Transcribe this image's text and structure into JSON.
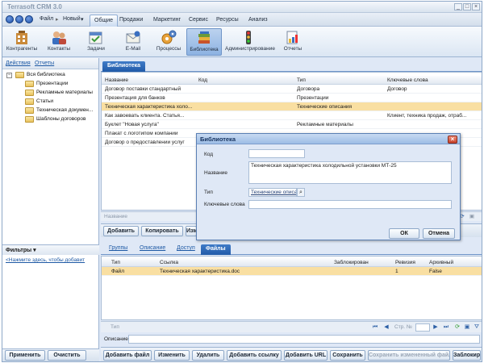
{
  "app": {
    "title": "Terrasoft CRM 3.0"
  },
  "menu": {
    "file": "Файл",
    "new": "Новый",
    "tabs": [
      "Общие",
      "Продажи",
      "Маркетинг",
      "Сервис",
      "Ресурсы",
      "Анализ"
    ],
    "active_tab": "Общие"
  },
  "ribbon": {
    "items": [
      {
        "label": "Контрагенты",
        "icon": "accounts-icon"
      },
      {
        "label": "Контакты",
        "icon": "contacts-icon"
      },
      {
        "label": "Задачи",
        "icon": "tasks-icon"
      },
      {
        "label": "E-Mail",
        "icon": "email-icon"
      },
      {
        "label": "Процессы",
        "icon": "processes-icon"
      },
      {
        "label": "Библиотека",
        "icon": "library-icon",
        "active": true
      },
      {
        "label": "Администрирование",
        "icon": "admin-icon"
      },
      {
        "label": "Отчеты",
        "icon": "reports-icon"
      }
    ]
  },
  "sidebar": {
    "actions": "Действия",
    "reports": "Отчеты",
    "tree": {
      "root": "Вся библиотека",
      "children": [
        "Презентации",
        "Рекламные материалы",
        "Статьи",
        "Техническая докумен...",
        "Шаблоны договоров"
      ]
    },
    "filters": {
      "title": "Фильтры",
      "link": "<Нажмите здесь, чтобы добавит"
    },
    "apply": "Применить",
    "clear": "Очистить"
  },
  "main": {
    "tab": "Библиотека",
    "columns": [
      "Название",
      "Код",
      "Тип",
      "Ключевые слова"
    ],
    "rows": [
      {
        "name": "Договор поставки стандартный",
        "code": "",
        "type": "Договора",
        "keywords": "Договор"
      },
      {
        "name": "Презентация для банков",
        "code": "",
        "type": "Презентации",
        "keywords": ""
      },
      {
        "name": "Техническая характеристика холо...",
        "code": "",
        "type": "Технические описания",
        "keywords": "",
        "selected": true
      },
      {
        "name": "Как завоевать клиента. Статья...",
        "code": "",
        "type": "",
        "keywords": "Клиент, техника продаж, отраб..."
      },
      {
        "name": "Буклет \"Новая услуга\"",
        "code": "",
        "type": "Рекламные материалы",
        "keywords": ""
      },
      {
        "name": "Плакат с логотипом компании",
        "code": "",
        "type": "",
        "keywords": ""
      },
      {
        "name": "Договор о предоставлении услуг",
        "code": "",
        "type": "",
        "keywords": ""
      }
    ],
    "footer_label": "Название",
    "buttons": [
      "Добавить",
      "Копировать",
      "Изм"
    ]
  },
  "detail": {
    "tabs": [
      "Группы",
      "Описание",
      "Доступ",
      "Файлы"
    ],
    "active_tab": "Файлы",
    "columns": [
      "Тип",
      "Ссылка",
      "Заблокирован",
      "Ревизия",
      "Архивный"
    ],
    "rows": [
      {
        "type": "Файл",
        "link": "Техническая характеристика.doc",
        "locked": "",
        "revision": "1",
        "archived": "False"
      }
    ],
    "footer_left": "Тип",
    "page_label": "Стр. №",
    "description_label": "Описание",
    "buttons": [
      "Добавить файл",
      "Изменить",
      "Удалить",
      "Добавить ссылку",
      "Добавить URL",
      "Сохранить",
      "Сохранить измененный файл",
      "Заблокир"
    ]
  },
  "dialog": {
    "title": "Библиотека",
    "code_label": "Код",
    "code_value": "",
    "name_label": "Название",
    "name_value": "Техническая характеристика холодильной установки МТ-25",
    "type_label": "Тип",
    "type_value": "Технические описа",
    "keywords_label": "Ключевые слова",
    "keywords_value": "",
    "ok": "ОК",
    "cancel": "Отмена"
  },
  "colors": {
    "accent": "#215aa8",
    "selected_row": "#f9dfa2",
    "panel": "#dfe8f6"
  }
}
